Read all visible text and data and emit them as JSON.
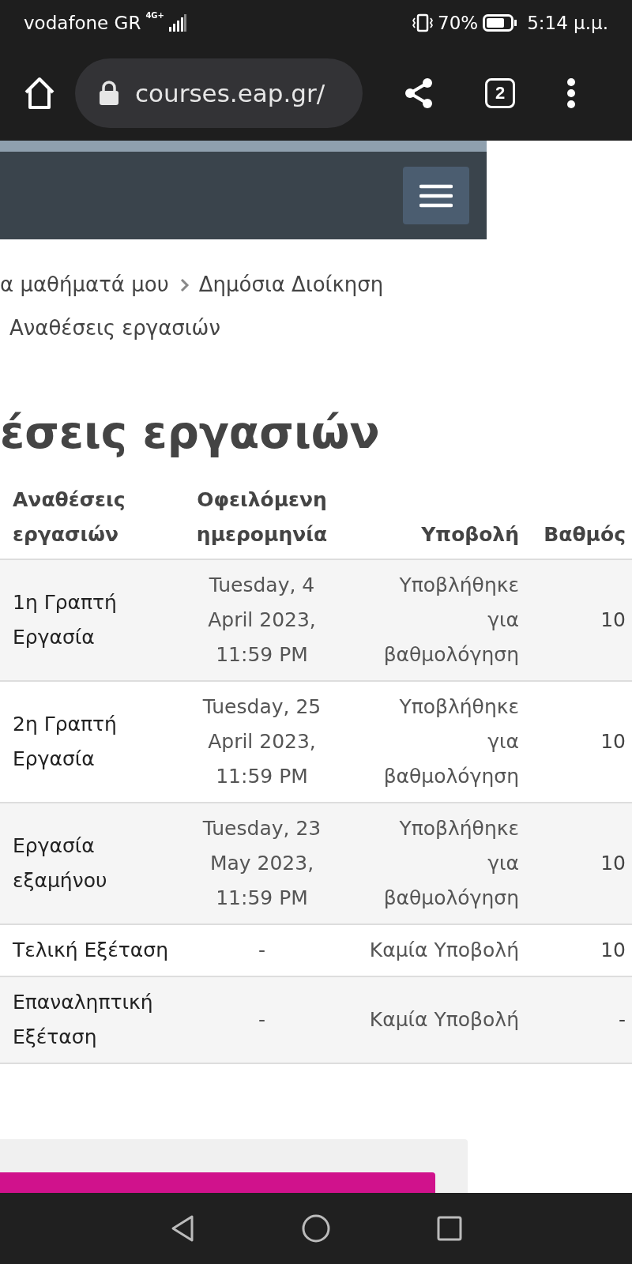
{
  "status_bar": {
    "carrier": "vodafone GR",
    "network": "4G+",
    "battery": "70%",
    "time": "5:14 μ.μ."
  },
  "browser": {
    "url": "courses.eap.gr/",
    "tab_count": "2"
  },
  "breadcrumb": [
    {
      "text": "α μαθήματά μου"
    },
    {
      "text": "Δημόσια Διοίκηση"
    },
    {
      "text": "Αναθέσεις εργασιών"
    }
  ],
  "title": "έσεις εργασιών",
  "table": {
    "columns": [
      "Αναθέσεις εργασιών",
      "Οφειλόμενη ημερομηνία",
      "Υποβολή",
      "Βαθμός"
    ],
    "rows": [
      {
        "cells": [
          "1η Γραπτή Εργασία",
          "Tuesday, 4 April 2023, 11:59 PM",
          "Υποβλήθηκε για βαθμολόγηση",
          "10"
        ]
      },
      {
        "cells": [
          "2η Γραπτή Εργασία",
          "Tuesday, 25 April 2023, 11:59 PM",
          "Υποβλήθηκε για βαθμολόγηση",
          "10"
        ]
      },
      {
        "cells": [
          "Εργασία εξαμήνου",
          "Tuesday, 23 May 2023, 11:59 PM",
          "Υποβλήθηκε για βαθμολόγηση",
          "10"
        ]
      },
      {
        "cells": [
          "Τελική Εξέταση",
          "-",
          "Καμία Υποβολή",
          "10"
        ]
      },
      {
        "cells": [
          "Επαναληπτική Εξέταση",
          "-",
          "Καμία Υποβολή",
          "-"
        ]
      }
    ]
  }
}
